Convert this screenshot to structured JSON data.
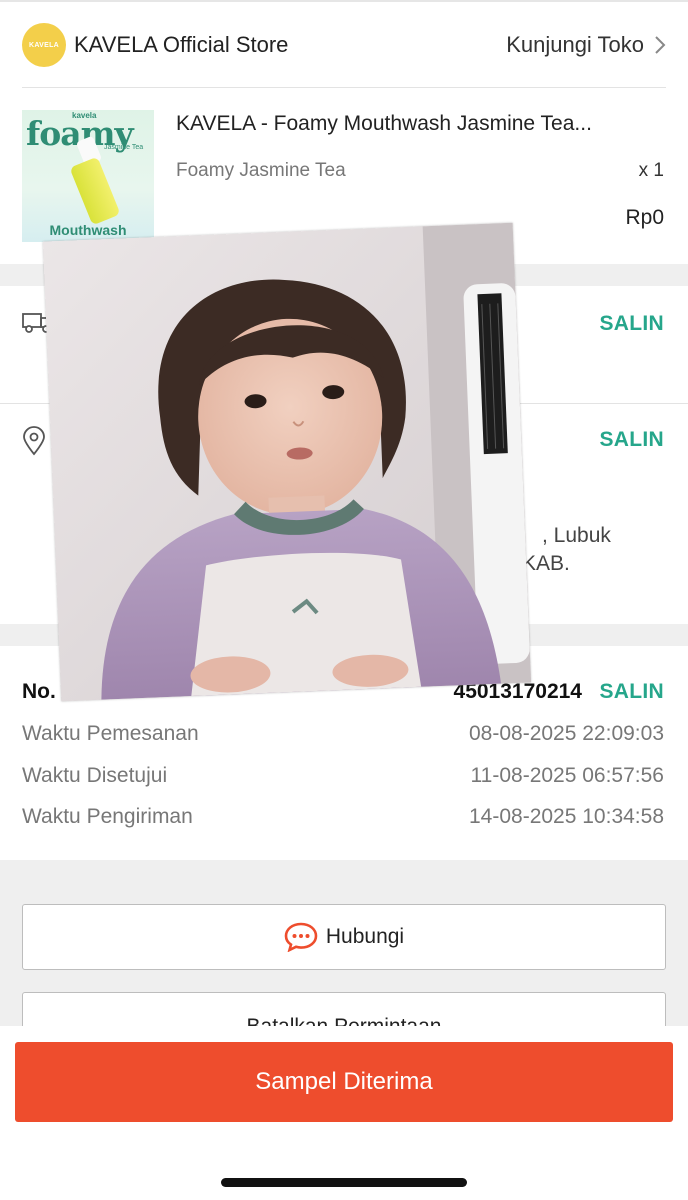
{
  "store": {
    "logo_text": "KAVELA",
    "name": "KAVELA Official Store",
    "visit_label": "Kunjungi Toko"
  },
  "product": {
    "image_brand": "kavela",
    "image_word": "foamy",
    "image_variant": "Jasmine Tea",
    "image_caption": "Mouthwash",
    "title": "KAVELA - Foamy Mouthwash Jasmine Tea...",
    "variant": "Foamy Jasmine Tea",
    "quantity": "x 1",
    "price": "Rp0"
  },
  "shipping": {
    "copy_label": "SALIN"
  },
  "address": {
    "copy_label": "SALIN",
    "line_fragment_1": ", Lubuk",
    "line_fragment_2": "KAB."
  },
  "order": {
    "number_label_visible": "No. P",
    "number_value_visible": "45013170214",
    "copy_label": "SALIN",
    "rows": [
      {
        "label": "Waktu Pemesanan",
        "value": "08-08-2025 22:09:03"
      },
      {
        "label": "Waktu Disetujui",
        "value": "11-08-2025 06:57:56"
      },
      {
        "label": "Waktu Pengiriman",
        "value": "14-08-2025 10:34:58"
      }
    ]
  },
  "actions": {
    "contact_label": "Hubungi",
    "cancel_label": "Batalkan Permintaan",
    "primary_label": "Sampel Diterima"
  },
  "colors": {
    "accent_green": "#26a68b",
    "primary_orange": "#ee4d2d",
    "logo_yellow": "#f3cf4a"
  }
}
